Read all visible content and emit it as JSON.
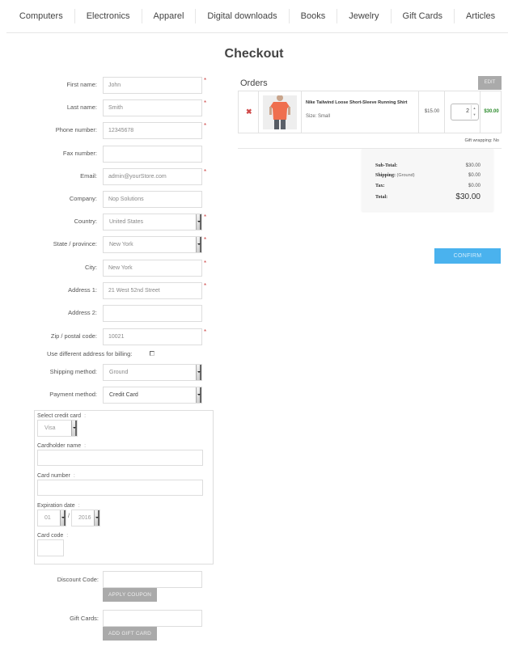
{
  "nav": {
    "items": [
      "Computers",
      "Electronics",
      "Apparel",
      "Digital downloads",
      "Books",
      "Jewelry",
      "Gift Cards",
      "Articles"
    ]
  },
  "page": {
    "title": "Checkout"
  },
  "form": {
    "fields": [
      {
        "label": "First name:",
        "value": "John",
        "required": true,
        "type": "text"
      },
      {
        "label": "Last name:",
        "value": "Smith",
        "required": true,
        "type": "text"
      },
      {
        "label": "Phone number:",
        "value": "12345678",
        "required": true,
        "type": "text"
      },
      {
        "label": "Fax number:",
        "value": "",
        "required": false,
        "type": "text"
      },
      {
        "label": "Email:",
        "value": "admin@yourStore.com",
        "required": true,
        "type": "text"
      },
      {
        "label": "Company:",
        "value": "Nop Solutions",
        "required": false,
        "type": "text"
      },
      {
        "label": "Country:",
        "value": "United States",
        "required": true,
        "type": "select"
      },
      {
        "label": "State / province:",
        "value": "New York",
        "required": true,
        "type": "select"
      },
      {
        "label": "City:",
        "value": "New York",
        "required": true,
        "type": "text"
      },
      {
        "label": "Address 1:",
        "value": "21 West 52nd Street",
        "required": true,
        "type": "text"
      },
      {
        "label": "Address 2:",
        "value": "",
        "required": false,
        "type": "text"
      },
      {
        "label": "Zip / postal code:",
        "value": "10021",
        "required": true,
        "type": "text"
      }
    ],
    "billing_label": "Use different address for billing:",
    "billing_checked": false,
    "shipping_method": {
      "label": "Shipping method:",
      "value": "Ground"
    },
    "payment_method": {
      "label": "Payment method:",
      "value": "Credit Card"
    },
    "required_mark": "*"
  },
  "credit_card": {
    "select_label": "Select credit card",
    "card_type": "Visa",
    "cardholder_label": "Cardholder name",
    "cardholder_value": "",
    "number_label": "Card number",
    "number_value": "",
    "expiration_label": "Expiration date",
    "exp_month": "01",
    "exp_separator": "/",
    "exp_year": "2016",
    "code_label": "Card code",
    "code_value": "",
    "colon": ":"
  },
  "discount": {
    "label": "Discount Code:",
    "value": "",
    "button": "APPLY COUPON"
  },
  "gift_card": {
    "label": "Gift Cards:",
    "value": "",
    "button": "ADD GIFT CARD"
  },
  "orders": {
    "title": "Orders",
    "edit_label": "EDIT",
    "items": [
      {
        "remove_icon": "✖",
        "name": "Nike Tailwind Loose Short-Sleeve Running Shirt",
        "attributes": "Size: Small",
        "unit_price": "$15.00",
        "quantity": "2",
        "total": "$30.00"
      }
    ],
    "gift_wrapping": "Gift wrapping: No"
  },
  "totals": {
    "subtotal_label": "Sub-Total:",
    "subtotal": "$30.00",
    "shipping_label": "Shipping:",
    "shipping_method": "(Ground)",
    "shipping": "$0.00",
    "tax_label": "Tax:",
    "tax": "$0.00",
    "total_label": "Total:",
    "total": "$30.00"
  },
  "confirm_label": "CONFIRM",
  "colors": {
    "confirm": "#4ab2ee",
    "gray_button": "#aaaaaa",
    "required": "#cc4444",
    "line_total": "#2a8a2a",
    "remove": "#d04a4a"
  }
}
